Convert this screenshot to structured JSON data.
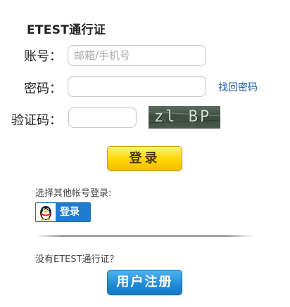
{
  "form": {
    "title": "ETEST通行证",
    "account_label": "账号：",
    "account_placeholder": "邮箱/手机号",
    "account_value": "",
    "password_label": "密码：",
    "password_value": "",
    "forgot_password": "找回密码",
    "captcha_label": "验证码：",
    "captcha_value": "",
    "captcha_image_text": "zl BP",
    "login_button": "登录"
  },
  "third_party": {
    "prompt": "选择其他帐号登录:",
    "qq_login_label": "登录",
    "qq_icon": "qq-penguin-icon"
  },
  "register": {
    "prompt": "没有ETEST通行证？",
    "button": "用户注册"
  },
  "colors": {
    "link": "#1f5fa8",
    "login_button": "#ffd600",
    "register_button": "#1f8ad6",
    "qq_button": "#1f7ccf"
  }
}
